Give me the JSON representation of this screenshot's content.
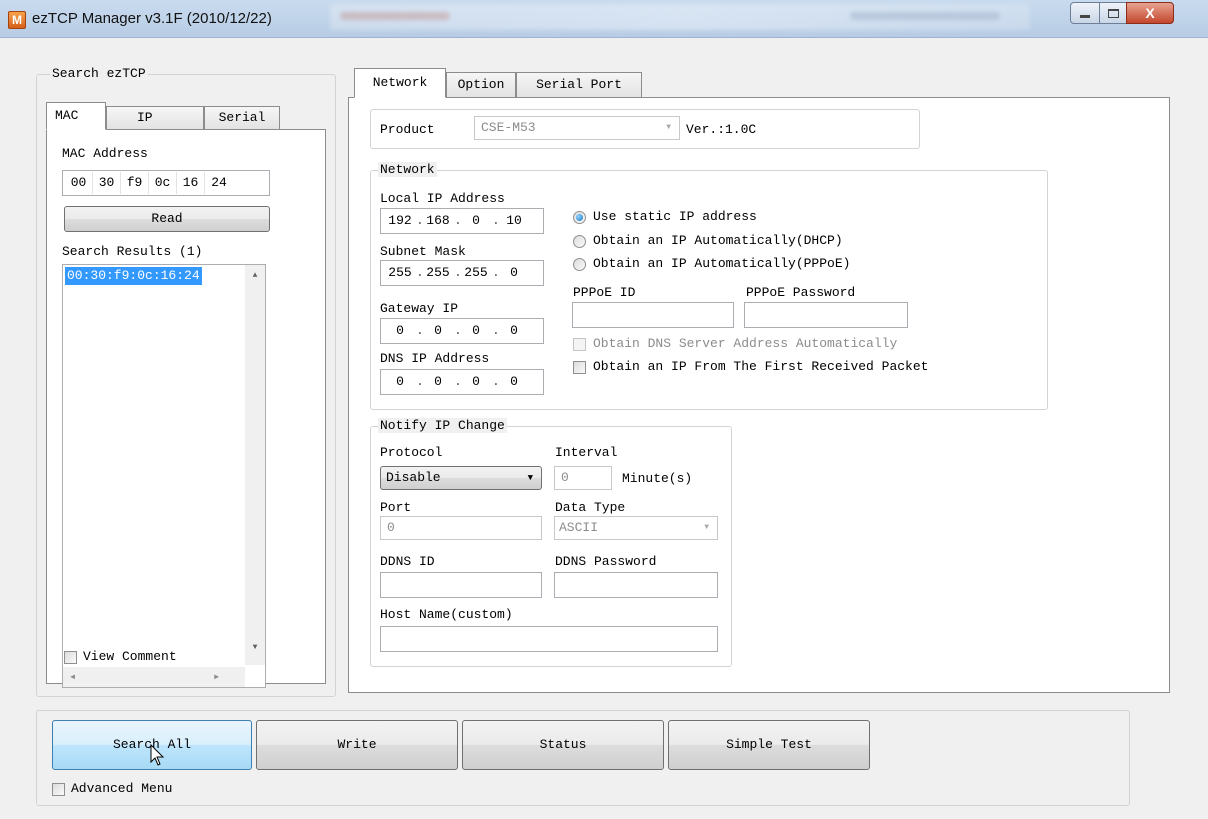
{
  "window": {
    "title": "ezTCP Manager v3.1F (2010/12/22)",
    "icon_letter": "M",
    "close_glyph": "X"
  },
  "search": {
    "group_label": "Search ezTCP",
    "tabs": [
      "MAC",
      "IP",
      "Serial"
    ],
    "active_tab": "MAC",
    "mac_label": "MAC Address",
    "mac_segments": [
      "00",
      "30",
      "f9",
      "0c",
      "16",
      "24"
    ],
    "read_button": "Read",
    "results_label": "Search Results (1)",
    "results": [
      "00:30:f9:0c:16:24"
    ],
    "view_comment": "View Comment",
    "arrows": {
      "up": "▲",
      "down": "▼",
      "left": "◂",
      "right": "▸"
    }
  },
  "tabs": {
    "items": [
      "Network",
      "Option",
      "Serial Port"
    ],
    "active": "Network"
  },
  "product": {
    "label": "Product",
    "value": "CSE-M53",
    "version": "Ver.:1.0C"
  },
  "network": {
    "group_label": "Network",
    "local_ip_label": "Local IP Address",
    "local_ip": [
      "192",
      "168",
      "0",
      "10"
    ],
    "subnet_label": "Subnet Mask",
    "subnet": [
      "255",
      "255",
      "255",
      "0"
    ],
    "gateway_label": "Gateway IP",
    "gateway": [
      "0",
      "0",
      "0",
      "0"
    ],
    "dns_label": "DNS IP Address",
    "dns": [
      "0",
      "0",
      "0",
      "0"
    ],
    "ip_mode_options": [
      "Use static IP address",
      "Obtain an IP Automatically(DHCP)",
      "Obtain an IP Automatically(PPPoE)"
    ],
    "ip_mode_selected": 0,
    "pppoe_id_label": "PPPoE ID",
    "pppoe_id": "",
    "pppoe_password_label": "PPPoE Password",
    "pppoe_password": "",
    "obtain_dns_auto": "Obtain DNS Server Address Automatically",
    "obtain_first_packet": "Obtain an IP From The First Received Packet"
  },
  "notify": {
    "group_label": "Notify IP Change",
    "protocol_label": "Protocol",
    "protocol_value": "Disable",
    "interval_label": "Interval",
    "interval_value": "0",
    "interval_unit": "Minute(s)",
    "port_label": "Port",
    "port_value": "0",
    "data_type_label": "Data Type",
    "data_type_value": "ASCII",
    "ddns_id_label": "DDNS ID",
    "ddns_id": "",
    "ddns_password_label": "DDNS Password",
    "ddns_password": "",
    "host_name_label": "Host Name(custom)",
    "host_name": ""
  },
  "bottom": {
    "search_all": "Search All",
    "write": "Write",
    "status": "Status",
    "simple_test": "Simple Test",
    "advanced_menu": "Advanced Menu"
  },
  "colors": {
    "selection": "#3399ff",
    "accent": "#1a6fc4"
  }
}
